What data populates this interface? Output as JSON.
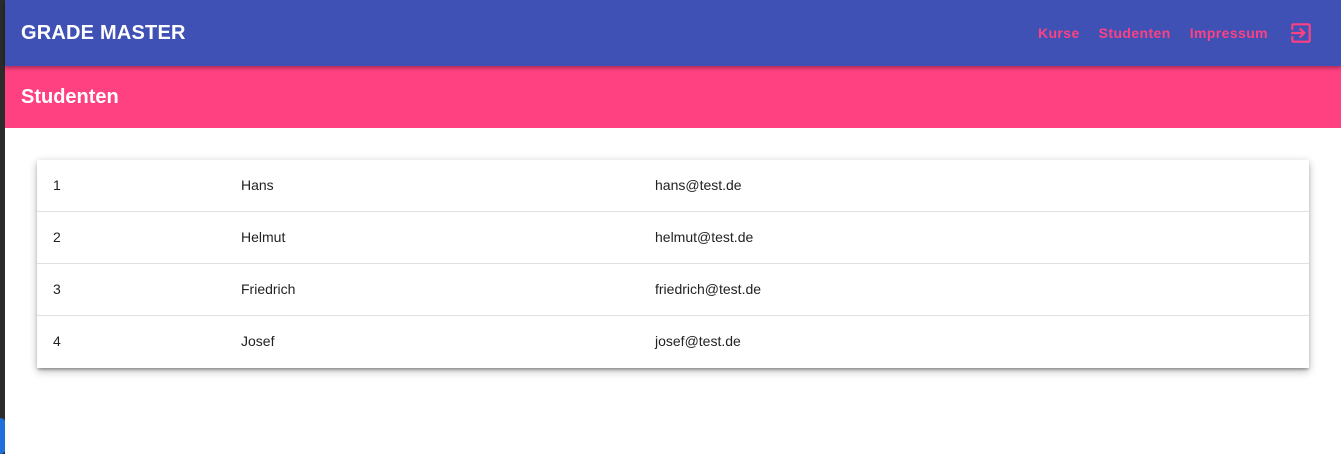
{
  "header": {
    "title": "GRADE MASTER",
    "nav": [
      {
        "label": "Kurse"
      },
      {
        "label": "Studenten"
      },
      {
        "label": "Impressum"
      }
    ],
    "logout_icon": "logout-icon"
  },
  "page": {
    "title": "Studenten"
  },
  "students": [
    {
      "id": "1",
      "name": "Hans",
      "email": "hans@test.de"
    },
    {
      "id": "2",
      "name": "Helmut",
      "email": "helmut@test.de"
    },
    {
      "id": "3",
      "name": "Friedrich",
      "email": "friedrich@test.de"
    },
    {
      "id": "4",
      "name": "Josef",
      "email": "josef@test.de"
    }
  ],
  "colors": {
    "primary": "#3f51b5",
    "accent": "#ff4081"
  }
}
